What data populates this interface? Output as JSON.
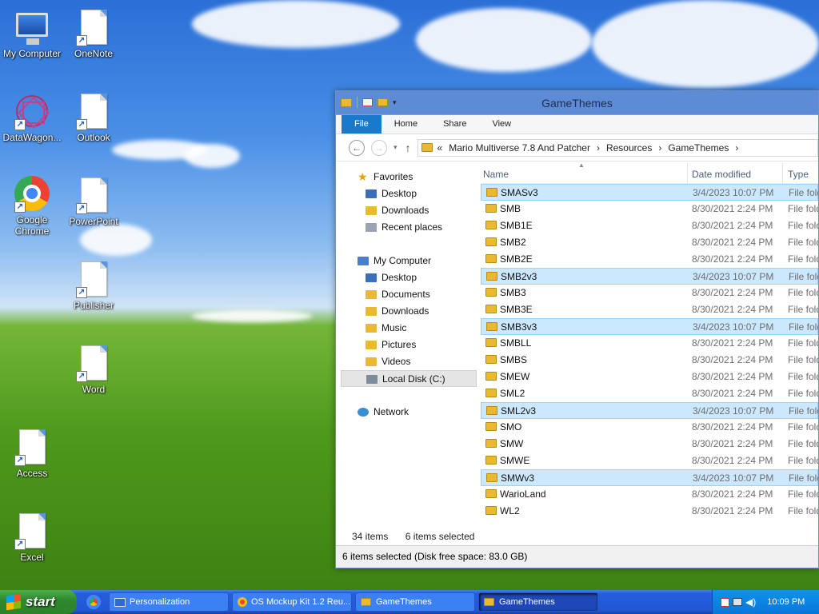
{
  "desktop": {
    "icons": [
      {
        "label": "My Computer"
      },
      {
        "label": "OneNote"
      },
      {
        "label": "DataWagon..."
      },
      {
        "label": "Outlook"
      },
      {
        "label": "Google Chrome"
      },
      {
        "label": "PowerPoint"
      },
      {
        "label": "Publisher"
      },
      {
        "label": "Word"
      },
      {
        "label": "Access"
      },
      {
        "label": "Excel"
      }
    ],
    "shortcut_glyph": "↗"
  },
  "explorer": {
    "title": "GameThemes",
    "ribbon_tabs": [
      "File",
      "Home",
      "Share",
      "View"
    ],
    "address": {
      "prefix": "«",
      "crumbs": [
        "Mario Multiverse 7.8 And Patcher",
        "Resources",
        "GameThemes"
      ],
      "sep": "›"
    },
    "nav": {
      "favorites": "Favorites",
      "desktop": "Desktop",
      "downloads": "Downloads",
      "recent": "Recent places",
      "computer": "My Computer",
      "c_desktop": "Desktop",
      "c_documents": "Documents",
      "c_downloads": "Downloads",
      "c_music": "Music",
      "c_pictures": "Pictures",
      "c_videos": "Videos",
      "c_local": "Local Disk (C:)",
      "network": "Network"
    },
    "columns": {
      "name": "Name",
      "date": "Date modified",
      "type": "Type"
    },
    "rows": [
      {
        "name": "SMASv3",
        "date": "3/4/2023 10:07 PM",
        "type": "File folder",
        "selected": true
      },
      {
        "name": "SMB",
        "date": "8/30/2021 2:24 PM",
        "type": "File folder",
        "selected": false
      },
      {
        "name": "SMB1E",
        "date": "8/30/2021 2:24 PM",
        "type": "File folder",
        "selected": false
      },
      {
        "name": "SMB2",
        "date": "8/30/2021 2:24 PM",
        "type": "File folder",
        "selected": false
      },
      {
        "name": "SMB2E",
        "date": "8/30/2021 2:24 PM",
        "type": "File folder",
        "selected": false
      },
      {
        "name": "SMB2v3",
        "date": "3/4/2023 10:07 PM",
        "type": "File folder",
        "selected": true
      },
      {
        "name": "SMB3",
        "date": "8/30/2021 2:24 PM",
        "type": "File folder",
        "selected": false
      },
      {
        "name": "SMB3E",
        "date": "8/30/2021 2:24 PM",
        "type": "File folder",
        "selected": false
      },
      {
        "name": "SMB3v3",
        "date": "3/4/2023 10:07 PM",
        "type": "File folder",
        "selected": true
      },
      {
        "name": "SMBLL",
        "date": "8/30/2021 2:24 PM",
        "type": "File folder",
        "selected": false
      },
      {
        "name": "SMBS",
        "date": "8/30/2021 2:24 PM",
        "type": "File folder",
        "selected": false
      },
      {
        "name": "SMEW",
        "date": "8/30/2021 2:24 PM",
        "type": "File folder",
        "selected": false
      },
      {
        "name": "SML2",
        "date": "8/30/2021 2:24 PM",
        "type": "File folder",
        "selected": false
      },
      {
        "name": "SML2v3",
        "date": "3/4/2023 10:07 PM",
        "type": "File folder",
        "selected": true
      },
      {
        "name": "SMO",
        "date": "8/30/2021 2:24 PM",
        "type": "File folder",
        "selected": false
      },
      {
        "name": "SMW",
        "date": "8/30/2021 2:24 PM",
        "type": "File folder",
        "selected": false
      },
      {
        "name": "SMWE",
        "date": "8/30/2021 2:24 PM",
        "type": "File folder",
        "selected": false
      },
      {
        "name": "SMWv3",
        "date": "3/4/2023 10:07 PM",
        "type": "File folder",
        "selected": true
      },
      {
        "name": "WarioLand",
        "date": "8/30/2021 2:24 PM",
        "type": "File folder",
        "selected": false
      },
      {
        "name": "WL2",
        "date": "8/30/2021 2:24 PM",
        "type": "File folder",
        "selected": false
      }
    ],
    "status": {
      "count": "34 items",
      "selected": "6 items selected"
    },
    "bottom_status": "6 items selected (Disk free space: 83.0 GB)"
  },
  "taskbar": {
    "start": "start",
    "tasks": [
      "Personalization",
      "OS Mockup Kit 1.2 Reu...",
      "GameThemes",
      "GameThemes"
    ],
    "clock": "10:09 PM"
  },
  "colors": {
    "folder": "#e8b931",
    "selection": "#cce8ff",
    "file_tab": "#1979ca",
    "titlebar": "#5d8bd6"
  }
}
